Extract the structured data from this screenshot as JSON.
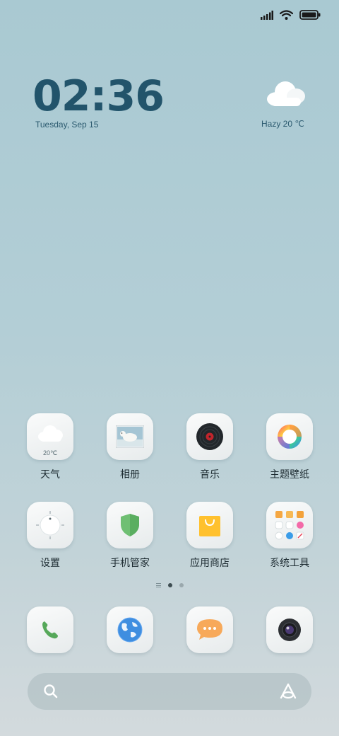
{
  "status_bar": {
    "signal_icon": "signal-bars-icon",
    "wifi_icon": "wifi-icon",
    "battery_icon": "battery-full-icon"
  },
  "clock": {
    "time": "02:36",
    "date": "Tuesday, Sep 15"
  },
  "weather_widget": {
    "icon": "cloud-icon",
    "text": "Hazy 20 ℃"
  },
  "apps_row1": [
    {
      "label": "天气",
      "icon": "weather-cloud-icon",
      "temp": "20℃"
    },
    {
      "label": "相册",
      "icon": "gallery-photo-icon"
    },
    {
      "label": "音乐",
      "icon": "vinyl-record-icon"
    },
    {
      "label": "主题壁纸",
      "icon": "theme-color-wheel-icon"
    }
  ],
  "apps_row2": [
    {
      "label": "设置",
      "icon": "settings-dial-icon"
    },
    {
      "label": "手机管家",
      "icon": "shield-icon"
    },
    {
      "label": "应用商店",
      "icon": "shopping-bag-icon"
    },
    {
      "label": "系统工具",
      "icon": "app-folder-icon"
    }
  ],
  "dock": [
    {
      "name": "phone",
      "icon": "phone-handset-icon"
    },
    {
      "name": "browser",
      "icon": "globe-icon"
    },
    {
      "name": "messages",
      "icon": "chat-bubble-icon"
    },
    {
      "name": "camera",
      "icon": "camera-lens-icon"
    }
  ],
  "pager": {
    "active_page": 1,
    "page_count": 2
  },
  "search": {
    "placeholder": "",
    "left_icon": "search-icon",
    "right_icon": "assistant-icon"
  }
}
